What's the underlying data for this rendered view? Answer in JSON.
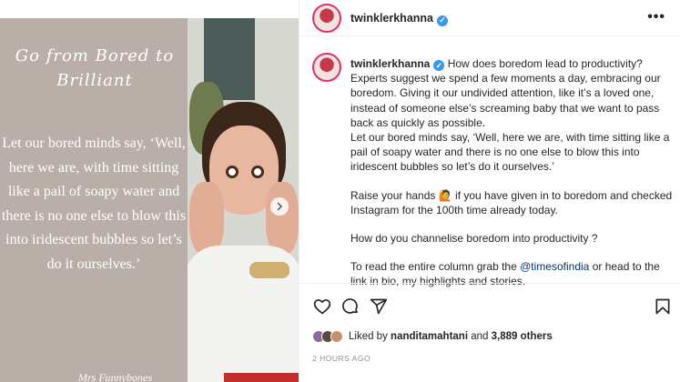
{
  "quote": {
    "title": "Go from Bored to Brilliant",
    "body": "Let our bored minds say, ‘Well, here we are, with time sitting like a pail of soapy water and there is no one else to blow this into iridescent bubbles so let’s do it ourselves.’",
    "signature": "Mrs Funnybones"
  },
  "header": {
    "username": "twinklerkhanna",
    "more": "•••"
  },
  "caption": {
    "username": "twinklerkhanna",
    "p1": "How does boredom lead to productivity? Experts suggest we spend a few moments a day, embracing our boredom. Giving it our undivided attention, like it’s a loved one, instead of someone else’s screaming baby that we want to pass back as quickly as possible.",
    "p2": "Let our bored minds say, ‘Well, here we are, with time sitting like a pail of soapy water and there is no one else to blow this into iridescent bubbles so let’s do it ourselves.’",
    "p3a": "Raise your hands",
    "p3_emoji": "🙋",
    "p3b": "if you have given in to boredom and checked Instagram for the 100th time already today.",
    "p4": "How do you channelise boredom into productivity ?",
    "p5a": "To read the entire column grab the",
    "p5_mention": "@timesofindia",
    "p5b": "or head to the link in bio, my highlights and stories."
  },
  "likes": {
    "prefix": "Liked by",
    "user": "nanditamahtani",
    "middle": "and",
    "count": "3,889 others"
  },
  "timestamp": "2 HOURS AGO",
  "icons": [
    "chevron-right-icon",
    "verified-badge-icon",
    "more-options-icon",
    "heart-icon",
    "comment-icon",
    "share-icon",
    "bookmark-icon"
  ],
  "colors": {
    "verified": "#3897f0",
    "mention": "#00376b",
    "quote_bg": "#b9afa8",
    "muted": "#8e8e8e"
  }
}
